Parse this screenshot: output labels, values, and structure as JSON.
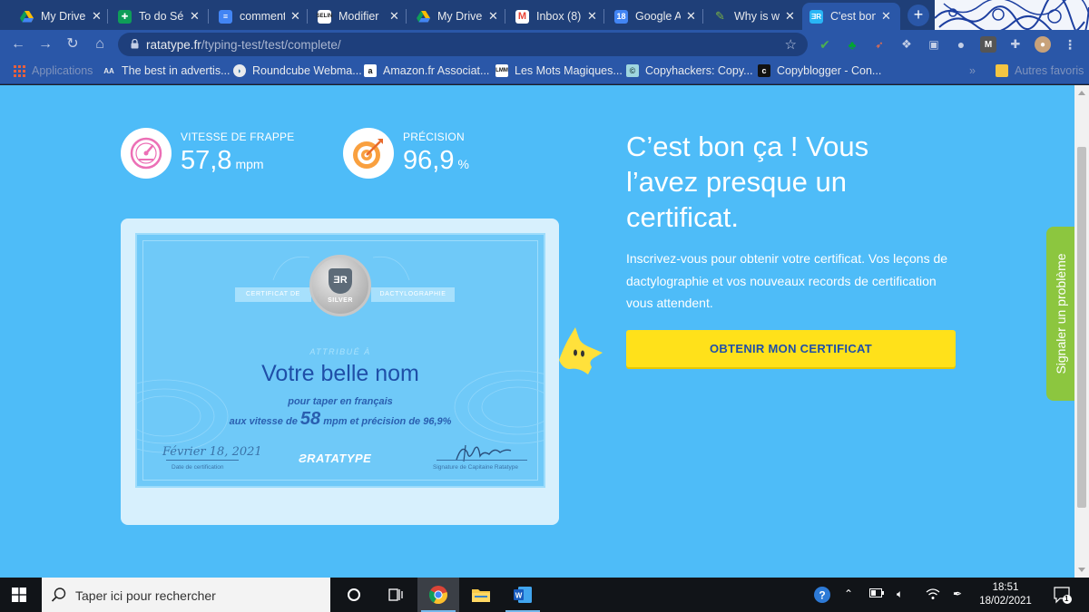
{
  "browser": {
    "tabs": [
      {
        "label": "My Drive",
        "icon": "google-drive-icon",
        "color": "#0f9d58",
        "active": false
      },
      {
        "label": "To do Séli",
        "icon": "google-sheets-icon",
        "color": "#0f9d58",
        "active": false
      },
      {
        "label": "comment",
        "icon": "google-docs-icon",
        "color": "#4285f4",
        "active": false
      },
      {
        "label": "Modifier",
        "icon": "selin-icon",
        "color": "#ffffff",
        "active": false
      },
      {
        "label": "My Drive",
        "icon": "google-drive-icon",
        "color": "#0f9d58",
        "active": false
      },
      {
        "label": "Inbox (8)",
        "icon": "gmail-icon",
        "color": "#ea4335",
        "active": false
      },
      {
        "label": "Google A",
        "icon": "google-calendar-icon",
        "color": "#4285f4",
        "active": false
      },
      {
        "label": "Why is w",
        "icon": "quill-icon",
        "color": "#7cb342",
        "active": false
      },
      {
        "label": "C'est bon",
        "icon": "ratatype-icon",
        "color": "#29b6f6",
        "active": true
      }
    ],
    "url_host": "ratatype.fr",
    "url_path": "/typing-test/test/complete/",
    "bookmarks": [
      {
        "label": "Applications",
        "icon": "apps-grid-icon",
        "faded": true
      },
      {
        "label": "The best in advertis...",
        "icon": "ad-icon",
        "faded": false
      },
      {
        "label": "Roundcube Webma...",
        "icon": "roundcube-icon",
        "faded": false
      },
      {
        "label": "Amazon.fr Associat...",
        "icon": "amazon-icon",
        "faded": false
      },
      {
        "label": "Les Mots Magiques...",
        "icon": "lmm-icon",
        "faded": false
      },
      {
        "label": "Copyhackers: Copy...",
        "icon": "copyhackers-icon",
        "faded": false
      },
      {
        "label": "Copyblogger - Con...",
        "icon": "copyblogger-icon",
        "faded": false
      }
    ],
    "bookmarks_more": "»",
    "other_bookmarks": "Autres favoris"
  },
  "page": {
    "speed_label": "VITESSE DE FRAPPE",
    "speed_value": "57,8",
    "speed_unit": "mpm",
    "accuracy_label": "PRÉCISION",
    "accuracy_value": "96,9",
    "accuracy_unit": "%",
    "certificate": {
      "ribbon_left": "CERTIFICAT DE",
      "ribbon_right": "DACTYLOGRAPHIE",
      "badge_letter": "R",
      "badge_level": "SILVER",
      "attributed": "ATTRIBUÉ À",
      "name": "Votre belle nom",
      "line1": "pour taper en français",
      "line2_pre": "aux vitesse de",
      "line2_speed": "58",
      "line2_post": "mpm et précision de 96,9%",
      "date": "Février 18, 2021",
      "date_caption": "Date de certification",
      "logo": "RATATYPE",
      "signature_caption": "Signature de Capitaine Ratatype"
    },
    "headline": "C’est bon ça ! Vous l’avez presque un certificat.",
    "paragraph": "Inscrivez-vous pour obtenir votre certificat. Vos leçons de dactylographie et vos nouveaux records de certification vous attendent.",
    "cta": "OBTENIR MON CERTIFICAT",
    "report": "Signaler un problème"
  },
  "taskbar": {
    "search_placeholder": "Taper ici pour rechercher",
    "time": "18:51",
    "date": "18/02/2021",
    "notifications": "1"
  }
}
